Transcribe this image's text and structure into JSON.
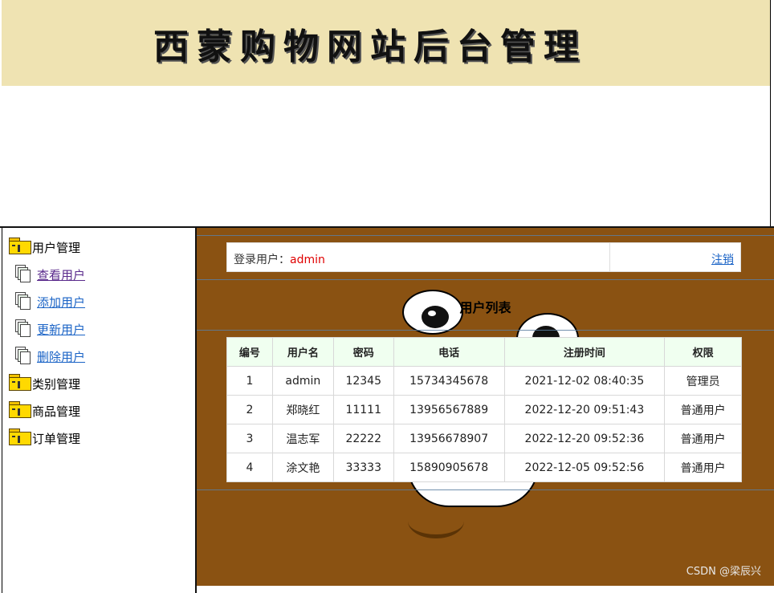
{
  "header": {
    "title": "西蒙购物网站后台管理"
  },
  "sidebar": {
    "groups": [
      {
        "label": "用户管理",
        "items": [
          {
            "label": "查看用户"
          },
          {
            "label": "添加用户"
          },
          {
            "label": "更新用户"
          },
          {
            "label": "删除用户"
          }
        ]
      },
      {
        "label": "类别管理"
      },
      {
        "label": "商品管理"
      },
      {
        "label": "订单管理"
      }
    ]
  },
  "login": {
    "prefix": "登录用户：",
    "username": "admin",
    "logout_label": "注销"
  },
  "user_list": {
    "title": "用户列表",
    "columns": [
      "编号",
      "用户名",
      "密码",
      "电话",
      "注册时间",
      "权限"
    ],
    "rows": [
      [
        "1",
        "admin",
        "12345",
        "15734345678",
        "2021-12-02 08:40:35",
        "管理员"
      ],
      [
        "2",
        "郑晓红",
        "11111",
        "13956567889",
        "2022-12-20 09:51:43",
        "普通用户"
      ],
      [
        "3",
        "温志军",
        "22222",
        "13956678907",
        "2022-12-20 09:52:36",
        "普通用户"
      ],
      [
        "4",
        "涂文艳",
        "33333",
        "15890905678",
        "2022-12-05 09:52:56",
        "普通用户"
      ]
    ]
  },
  "watermark": "CSDN @梁辰兴",
  "colors": {
    "banner_bg": "#efe3b2",
    "main_bg": "#8a5212",
    "link": "#1a63c6",
    "login_user": "#e00000",
    "table_header_bg": "#f0fff0"
  }
}
